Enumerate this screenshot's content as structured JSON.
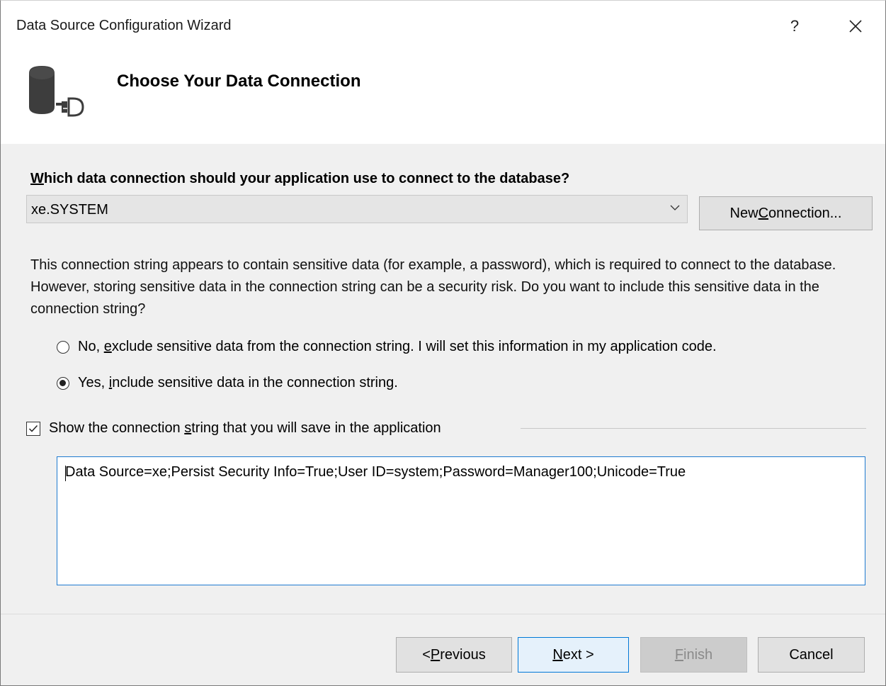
{
  "window": {
    "title": "Data Source Configuration Wizard",
    "help_label": "?"
  },
  "header": {
    "title": "Choose Your Data Connection"
  },
  "connection": {
    "question_mnemonic": "W",
    "question_rest": "hich data connection should your application use to connect to the database?",
    "selected": "xe.SYSTEM",
    "new_button_pre": "New ",
    "new_button_mnemonic": "C",
    "new_button_post": "onnection..."
  },
  "sensitive": {
    "description": "This connection string appears to contain sensitive data (for example, a password), which is required to connect to the database. However, storing sensitive data in the connection string can be a security risk. Do you want to include this sensitive data in the connection string?",
    "option_no_pre": "No, ",
    "option_no_mnemonic": "e",
    "option_no_post": "xclude sensitive data from the connection string. I will set this information in my application code.",
    "option_yes_pre": "Yes, ",
    "option_yes_mnemonic": "i",
    "option_yes_post": "nclude sensitive data in the connection string.",
    "selected": "yes"
  },
  "show_string": {
    "label_pre": "Show the connection ",
    "label_mnemonic": "s",
    "label_post": "tring that you will save in the application",
    "checked": true,
    "value": "Data Source=xe;Persist Security Info=True;User ID=system;Password=Manager100;Unicode=True"
  },
  "buttons": {
    "previous_pre": "< ",
    "previous_mnemonic": "P",
    "previous_post": "revious",
    "next_mnemonic": "N",
    "next_post": "ext >",
    "finish_mnemonic": "F",
    "finish_post": "inish",
    "cancel": "Cancel"
  }
}
